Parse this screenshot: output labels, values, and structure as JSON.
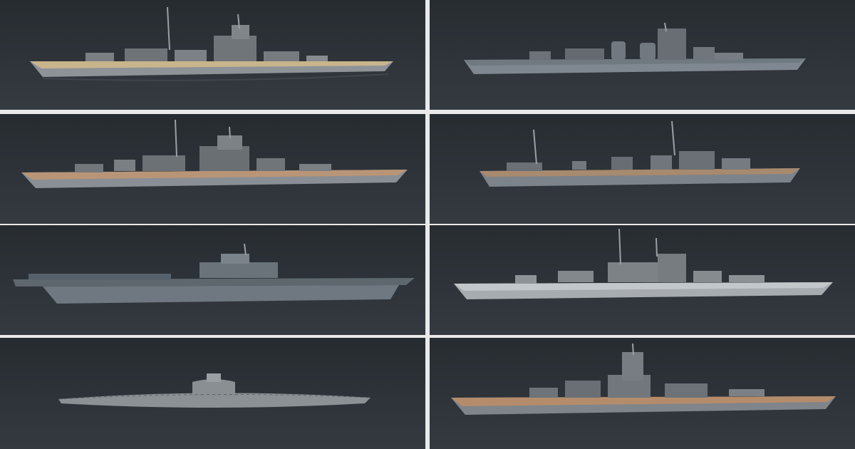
{
  "tiles": [
    {
      "subject": "battleship-wood-deck",
      "hull_color": "#8e9398",
      "deck_color": "#c9b58c"
    },
    {
      "subject": "cruiser-grey-deck",
      "hull_color": "#7f8790",
      "deck_color": "#6f7a80"
    },
    {
      "subject": "battleship-wood-deck",
      "hull_color": "#8a8f95",
      "deck_color": "#b99577"
    },
    {
      "subject": "destroyer",
      "hull_color": "#7d838a",
      "deck_color": "#a88a6f"
    },
    {
      "subject": "aircraft-carrier",
      "hull_color": "#6f7880",
      "deck_color": "#5e676e"
    },
    {
      "subject": "battleship-light-grey",
      "hull_color": "#a7acb0",
      "deck_color": "#c4c7c9"
    },
    {
      "subject": "submarine",
      "hull_color": "#8c9196",
      "deck_color": "#979ca0"
    },
    {
      "subject": "battleship-large-wood",
      "hull_color": "#7f858b",
      "deck_color": "#b58c6b"
    }
  ],
  "colors": {
    "sea": "#30363b",
    "divider": "#e9e9e9"
  }
}
